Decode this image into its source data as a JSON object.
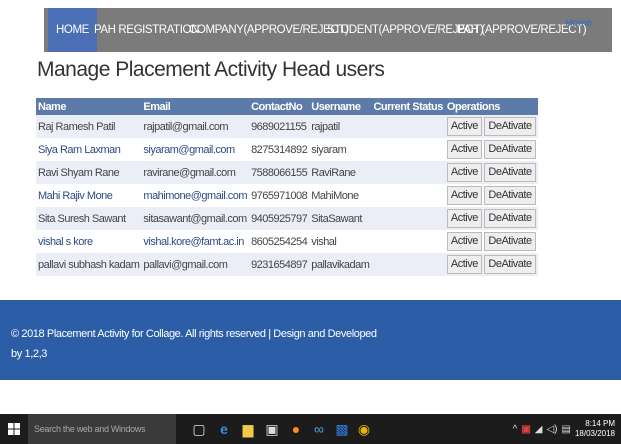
{
  "nav": {
    "items": [
      "HOME",
      "PAH REGISTRATION",
      "COMPANY(APPROVE/REJECT)",
      "STUDENT(APPROVE/REJECT)",
      "PAH (APPROVE/REJECT)"
    ],
    "home_link": "Home"
  },
  "page_title": "Manage Placement Activity Head users",
  "table": {
    "headers": [
      "Name",
      "Email",
      "ContactNo",
      "Username",
      "Current Status",
      "Operations"
    ],
    "rows": [
      {
        "name": "Raj Ramesh Patil",
        "email": "rajpatil@gmail.com",
        "contact": "9689021155",
        "username": "rajpatil",
        "status": "",
        "activate": "Active",
        "deactivate": "DeAtivate"
      },
      {
        "name": "Siya Ram Laxman",
        "email": "siyaram@gmail.com",
        "contact": "8275314892",
        "username": "siyaram",
        "status": "",
        "activate": "Active",
        "deactivate": "DeAtivate"
      },
      {
        "name": "Ravi Shyam Rane",
        "email": "ravirane@gmail.com",
        "contact": "7588066155",
        "username": "RaviRane",
        "status": "",
        "activate": "Active",
        "deactivate": "DeAtivate"
      },
      {
        "name": "Mahi Rajiv Mone",
        "email": "mahimone@gmail.com",
        "contact": "9765971008",
        "username": "MahiMone",
        "status": "",
        "activate": "Active",
        "deactivate": "DeAtivate"
      },
      {
        "name": "Sita Suresh Sawant",
        "email": "sitasawant@gmail.com",
        "contact": "9405925797",
        "username": "SitaSawant",
        "status": "",
        "activate": "Active",
        "deactivate": "DeAtivate"
      },
      {
        "name": "vishal s kore",
        "email": "vishal.kore@famt.ac.in",
        "contact": "8605254254",
        "username": "vishal",
        "status": "",
        "activate": "Active",
        "deactivate": "DeAtivate"
      },
      {
        "name": "pallavi subhash kadam",
        "email": "pallavi@gmail.com",
        "contact": "9231654897",
        "username": "pallavikadam",
        "status": "",
        "activate": "Active",
        "deactivate": "DeAtivate"
      }
    ]
  },
  "footer": {
    "line1": "© 2018 Placement Activity for Collage. All rights reserved | Design and Developed",
    "line2": "by 1,2,3"
  },
  "taskbar": {
    "search_placeholder": "Search the web and Windows",
    "time": "8:14 PM",
    "date": "18/03/2018",
    "icons": [
      "windows-start-icon",
      "task-view-icon",
      "edge-icon",
      "file-explorer-icon",
      "store-icon",
      "firefox-icon",
      "app-icon",
      "outlook-icon",
      "chrome-icon"
    ]
  }
}
